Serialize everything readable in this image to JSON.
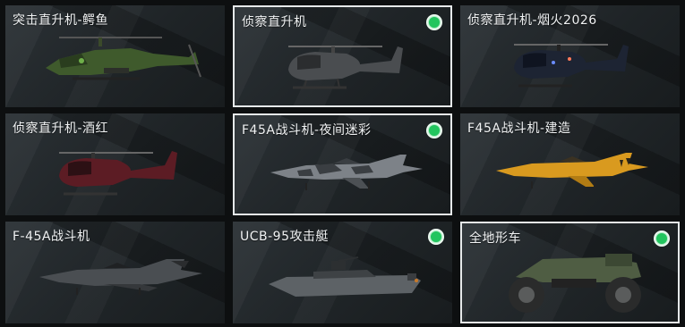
{
  "vehicles": [
    {
      "label": "突击直升机-鳄鱼",
      "selected": false,
      "equipped": false,
      "icon": "attack-helicopter-icon"
    },
    {
      "label": "侦察直升机",
      "selected": true,
      "equipped": true,
      "icon": "scout-helicopter-icon"
    },
    {
      "label": "侦察直升机-烟火2026",
      "selected": false,
      "equipped": false,
      "icon": "scout-helicopter-icon"
    },
    {
      "label": "侦察直升机-酒红",
      "selected": false,
      "equipped": false,
      "icon": "scout-helicopter-icon"
    },
    {
      "label": "F45A战斗机-夜间迷彩",
      "selected": true,
      "equipped": true,
      "icon": "fighter-jet-icon"
    },
    {
      "label": "F45A战斗机-建造",
      "selected": false,
      "equipped": false,
      "icon": "fighter-jet-icon"
    },
    {
      "label": "F-45A战斗机",
      "selected": false,
      "equipped": false,
      "icon": "stealth-fighter-icon"
    },
    {
      "label": "UCB-95攻击艇",
      "selected": false,
      "equipped": true,
      "icon": "attack-boat-icon"
    },
    {
      "label": "全地形车",
      "selected": true,
      "equipped": true,
      "icon": "atv-icon"
    }
  ],
  "colors": {
    "equipped_dot": "#22c55e",
    "selected_border": "#e6e9ea"
  }
}
